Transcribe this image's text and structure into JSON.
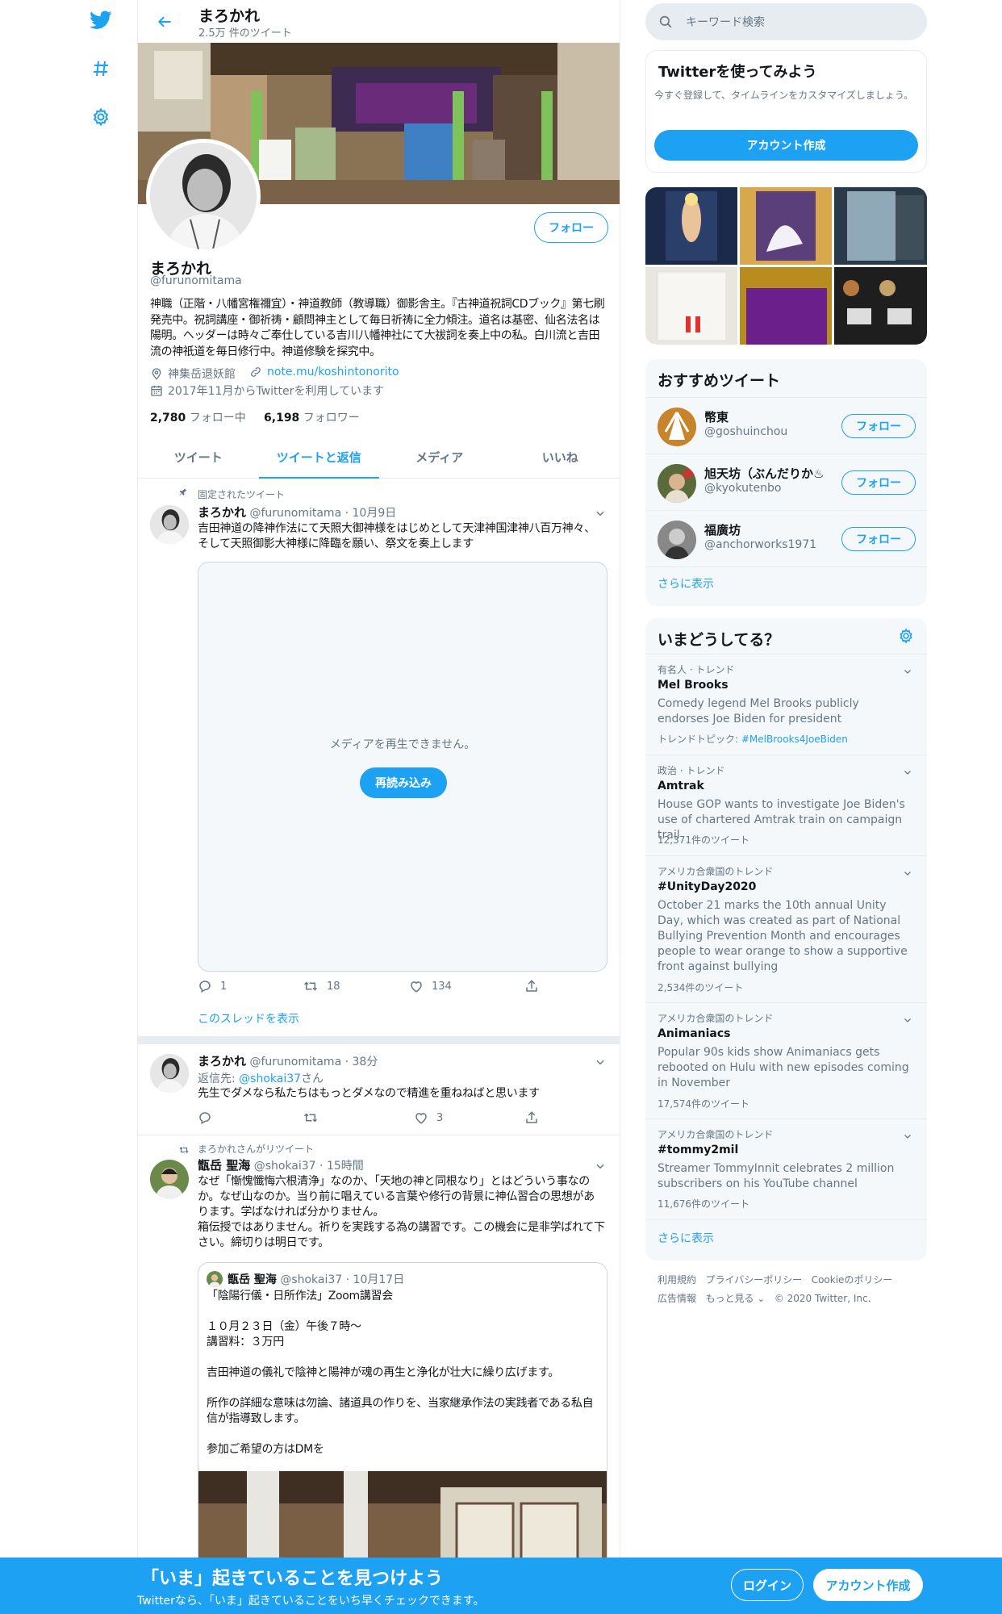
{
  "colors": {
    "accent": "#1da1f2",
    "muted": "#657786",
    "border": "#e6ecf0",
    "panel": "#f5f8fa"
  },
  "nav": {
    "icons": [
      "twitter-logo-icon",
      "hashtag-icon",
      "settings-gear-icon"
    ]
  },
  "header": {
    "name": "まろかれ",
    "tweet_count": "2.5万 件のツイート"
  },
  "profile": {
    "name": "まろかれ",
    "handle": "@furunomitama",
    "follow_label": "フォロー",
    "bio": "神職（正階・八幡宮権禰宜）・神道教師（教導職）御影舎主。『古神道祝詞CDブック』第七刷発売中。祝詞講座・御祈祷・顧問神主として毎日祈祷に全力傾注。道名は基密、仙名法名は陽明。ヘッダーは時々ご奉仕している吉川八幡神社にて大祓詞を奏上中の私。白川流と吉田流の神祇道を毎日修行中。神道修験を探究中。",
    "location": "神集岳退妖館",
    "link": "note.mu/koshintonorito",
    "joined": "2017年11月からTwitterを利用しています",
    "following_count": "2,780",
    "following_label": "フォロー中",
    "followers_count": "6,198",
    "followers_label": "フォロワー"
  },
  "tabs": [
    "ツイート",
    "ツイートと返信",
    "メディア",
    "いいね"
  ],
  "tweets": [
    {
      "pinned_label": "固定されたツイート",
      "name": "まろかれ",
      "handle": "@furunomitama",
      "time": "10月9日",
      "text": "吉田神道の降神作法にて天照大御神様をはじめとして天津神国津神八百万神々、そして天照御影大神様に降臨を願い、祭文を奏上します",
      "media_error": "メディアを再生できません。",
      "reload_label": "再読み込み",
      "replies": "1",
      "retweets": "18",
      "likes": "134",
      "thread_link": "このスレッドを表示"
    },
    {
      "name": "まろかれ",
      "handle": "@furunomitama",
      "time": "38分",
      "reply_to_prefix": "返信先: ",
      "reply_to_handle": "@shokai37",
      "reply_to_suffix": "さん",
      "text": "先生でダメなら私たちはもっとダメなので精進を重ねねばと思います",
      "likes": "3"
    },
    {
      "retweet_label": "まろかれさんがリツイート",
      "name": "甑岳 聖海",
      "handle": "@shokai37",
      "time": "15時間",
      "text": "なぜ「慚愧懺悔六根清浄」なのか、「天地の神と同根なり」とはどういう事なのか。なぜ山なのか。当り前に唱えている言葉や修行の背景に神仏習合の思想があります。学ばなければ分かりません。\n箱伝授ではありません。祈りを実践する為の講習です。この機会に是非学ばれて下さい。締切りは明日です。",
      "quote": {
        "name": "甑岳 聖海",
        "handle": "@shokai37",
        "time": "10月17日",
        "text": "「陰陽行儀・日所作法」Zoom講習会\n\n１０月２３日（金）午後７時～\n講習料：３万円\n\n吉田神道の儀礼で陰神と陽神が魂の再生と浄化が壮大に繰り広げます。\n\n所作の詳細な意味は勿論、諸道具の作りを、当家継承作法の実践者である私自信が指導致します。\n\n参加ご希望の方はDMを"
      }
    }
  ],
  "search": {
    "placeholder": "キーワード検索"
  },
  "signup_card": {
    "title": "Twitterを使ってみよう",
    "text": "今すぐ登録して、タイムラインをカスタマイズしましょう。",
    "button": "アカウント作成"
  },
  "recommended": {
    "title": "おすすめツイート",
    "users": [
      {
        "name": "幣東",
        "handle": "@goshuinchou",
        "button": "フォロー"
      },
      {
        "name": "旭天坊（ぶんだりか♨",
        "handle": "@kyokutenbo",
        "button": "フォロー"
      },
      {
        "name": "福廣坊",
        "handle": "@anchorworks1971",
        "button": "フォロー"
      }
    ],
    "more": "さらに表示"
  },
  "trends": {
    "title": "いまどうしてる？",
    "items": [
      {
        "category": "有名人 · トレンド",
        "title": "Mel Brooks",
        "desc": "Comedy legend Mel Brooks publicly endorses Joe Biden for president",
        "extra_prefix": "トレンドトピック: ",
        "extra_tag": "#MelBrooks4JoeBiden"
      },
      {
        "category": "政治 · トレンド",
        "title": "Amtrak",
        "desc": "House GOP wants to investigate Joe Biden's use of chartered Amtrak train on campaign trail",
        "count": "12,371件のツイート"
      },
      {
        "category": "アメリカ合衆国のトレンド",
        "title": "#UnityDay2020",
        "desc": "October 21 marks the 10th annual Unity Day, which was created as part of National Bullying Prevention Month and encourages people to wear orange to show a supportive front against bullying",
        "count": "2,534件のツイート"
      },
      {
        "category": "アメリカ合衆国のトレンド",
        "title": "Animaniacs",
        "desc": "Popular 90s kids show Animaniacs gets rebooted on Hulu with new episodes coming in November",
        "count": "17,574件のツイート"
      },
      {
        "category": "アメリカ合衆国のトレンド",
        "title": "#tommy2mil",
        "desc": "Streamer TommyInnit celebrates 2 million subscribers on his YouTube channel",
        "count": "11,676件のツイート"
      }
    ],
    "more": "さらに表示"
  },
  "footer": {
    "links": [
      "利用規約",
      "プライバシーポリシー",
      "Cookieのポリシー",
      "広告情報",
      "もっと見る"
    ],
    "copyright": "© 2020 Twitter, Inc."
  },
  "bottom_bar": {
    "title": "「いま」起きていることを見つけよう",
    "subtitle": "Twitterなら、「いま」起きていることをいち早くチェックできます。",
    "login": "ログイン",
    "signup": "アカウント作成"
  }
}
